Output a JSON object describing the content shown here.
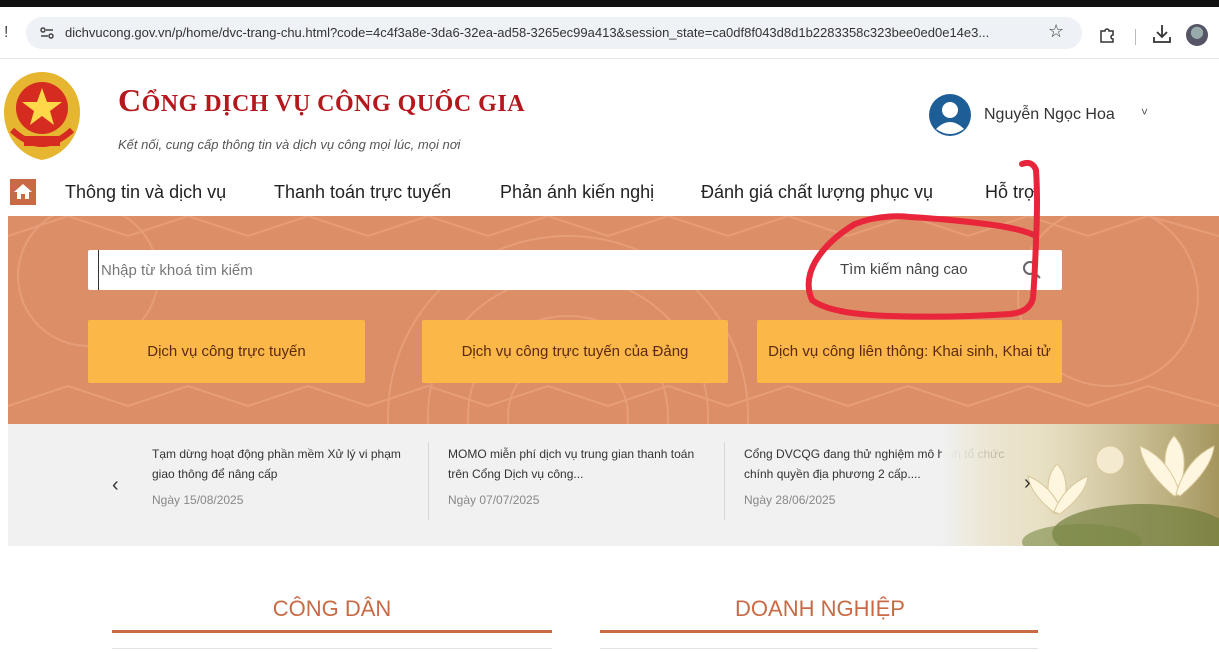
{
  "browser": {
    "url": "dichvucong.gov.vn/p/home/dvc-trang-chu.html?code=4c4f3a8e-3da6-32ea-ad58-3265ec99a413&session_state=ca0df8f043d8d1b2283358c323bee0ed0e14e3...",
    "left_glyph": "!",
    "icons": [
      "site-info-icon",
      "star-icon",
      "extensions-icon",
      "download-icon",
      "profile-icon"
    ]
  },
  "header": {
    "title_initial": "C",
    "title_rest": "ỔNG DỊCH VỤ CÔNG QUỐC GIA",
    "subtitle": "Kết nối, cung cấp thông tin và dịch vụ công mọi lúc, mọi nơi",
    "user_name": "Nguyễn Ngọc Hoa",
    "user_chevron": "˅"
  },
  "nav": {
    "items": [
      {
        "label": "Thông tin và dịch vụ"
      },
      {
        "label": "Thanh toán trực tuyến"
      },
      {
        "label": "Phản ánh kiến nghị"
      },
      {
        "label": "Đánh giá chất lượng phục vụ"
      },
      {
        "label": "Hỗ trợ"
      }
    ]
  },
  "search": {
    "placeholder": "Nhập từ khoá tìm kiếm",
    "advanced_label": "Tìm kiếm nâng cao"
  },
  "quick_links": [
    {
      "label": "Dịch vụ công trực tuyến"
    },
    {
      "label": "Dịch vụ công trực tuyến của Đảng"
    },
    {
      "label": "Dịch vụ công liên thông: Khai sinh, Khai tử"
    }
  ],
  "news": {
    "prev": "‹",
    "next": "›",
    "items": [
      {
        "title": "Tạm dừng hoạt động phần mềm Xử lý vi phạm giao thông để nâng cấp",
        "date": "Ngày 15/08/2025"
      },
      {
        "title": "MOMO miễn phí dịch vụ trung gian thanh toán trên Cổng Dịch vụ công...",
        "date": "Ngày 07/07/2025"
      },
      {
        "title": "Cổng DVCQG đang thử nghiệm mô hình tổ chức chính quyền địa phương 2 cấp....",
        "date": "Ngày 28/06/2025"
      }
    ]
  },
  "sections": {
    "citizen": "CÔNG DÂN",
    "business": "DOANH NGHIỆP"
  },
  "colors": {
    "brand_red": "#b4181d",
    "hero_bg": "#dc8e66",
    "button_yellow": "#fbb748",
    "section_accent": "#c86b45",
    "annotation_red": "#e8253a"
  }
}
